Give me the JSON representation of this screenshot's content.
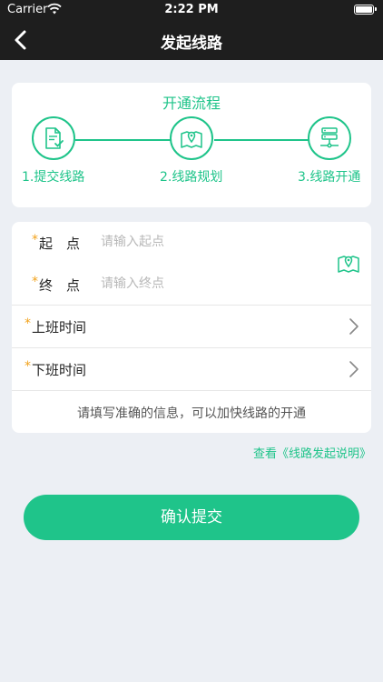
{
  "statusbar": {
    "carrier": "Carrier",
    "time": "2:22 PM"
  },
  "navbar": {
    "title": "发起线路",
    "back_icon": "chevron-left-icon"
  },
  "process": {
    "title": "开通流程",
    "steps": [
      {
        "label": "1.提交线路",
        "icon": "document-check-icon"
      },
      {
        "label": "2.线路规划",
        "icon": "map-pin-icon"
      },
      {
        "label": "3.线路开通",
        "icon": "server-network-icon"
      }
    ]
  },
  "form": {
    "required_mark": "*",
    "start": {
      "label": "起　点",
      "placeholder": "请输入起点",
      "value": ""
    },
    "end": {
      "label": "终　点",
      "placeholder": "请输入终点",
      "value": ""
    },
    "route_map_icon": "map-pin-icon",
    "work_start": {
      "label": "上班时间"
    },
    "work_end": {
      "label": "下班时间"
    },
    "hint": "请填写准确的信息，可以加快线路的开通"
  },
  "link": "查看《线路发起说明》",
  "submit_label": "确认提交",
  "colors": {
    "accent": "#1fc48a",
    "required": "#f2a21b",
    "header": "#1e1e1e",
    "background": "#eceff4"
  }
}
